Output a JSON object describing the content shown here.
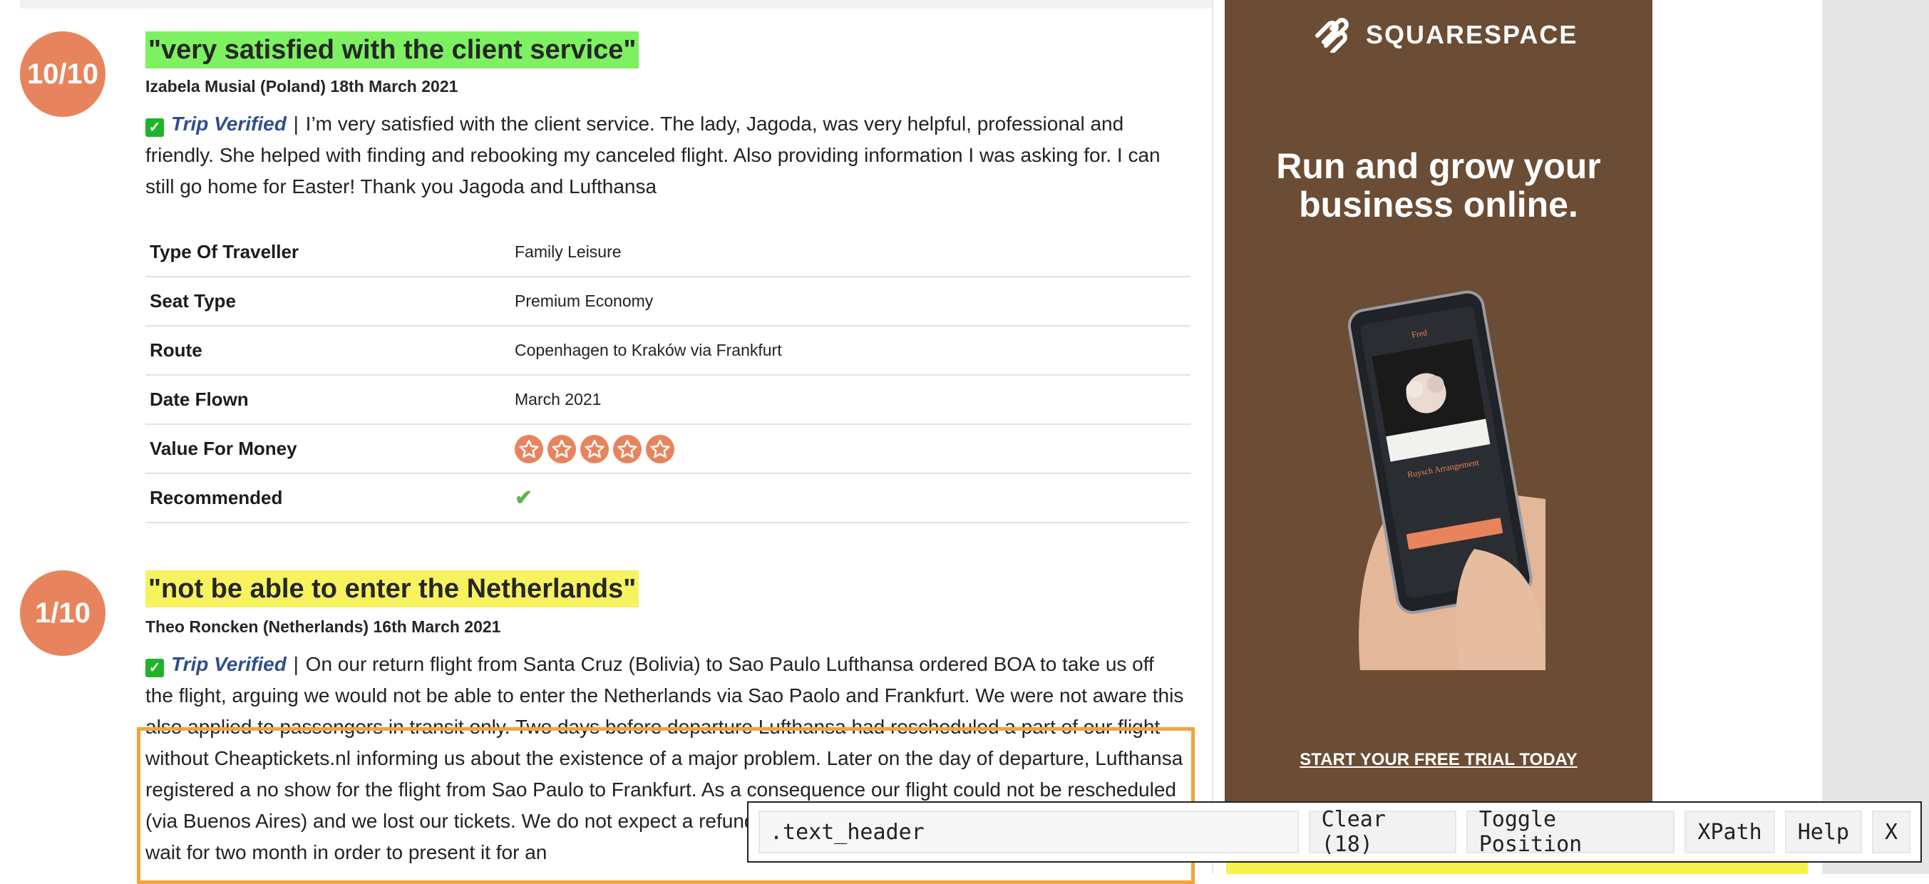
{
  "reviews": [
    {
      "rating": "10/10",
      "title": "\"very satisfied with the client service\"",
      "author": "Izabela Musial (Poland) 18th March 2021",
      "verified_label": "Trip Verified",
      "separator": "|",
      "text": "I’m very satisfied with the client service. The lady, Jagoda, was very helpful, professional and friendly. She helped with finding and rebooking my canceled flight. Also providing information I was asking for. I can still go home for Easter! Thank you Jagoda and Lufthansa",
      "details": [
        {
          "key": "Type Of Traveller",
          "value": "Family Leisure"
        },
        {
          "key": "Seat Type",
          "value": "Premium Economy"
        },
        {
          "key": "Route",
          "value": "Copenhagen to Kraków via Frankfurt"
        },
        {
          "key": "Date Flown",
          "value": "March 2021"
        },
        {
          "key": "Value For Money",
          "stars": 5
        },
        {
          "key": "Recommended",
          "icon": "checkmark-icon"
        }
      ]
    },
    {
      "rating": "1/10",
      "title": "\"not be able to enter the Netherlands\"",
      "author": "Theo Roncken (Netherlands) 16th March 2021",
      "verified_label": "Trip Verified",
      "separator": "|",
      "text": "On our return flight from Santa Cruz (Bolivia) to Sao Paulo Lufthansa ordered BOA to take us off the flight, arguing we would not be able to enter the Netherlands via Sao Paolo and Frankfurt. We were not aware this also applied to passengers in transit only. Two days before departure Lufthansa had rescheduled a part of our flight without Cheaptickets.nl informing us about the existence of a major problem. Later on the day of departure, Lufthansa registered a no show for the flight from Sao Paulo to Frankfurt. As a consequence our flight could not be rescheduled (via Buenos Aires) and we lost our tickets. We do not expect a refund for the tickets, and filed a claim but now have to wait for two month in order to present it for an"
    }
  ],
  "ad": {
    "brand": "SQUARESPACE",
    "headline_line1": "Run and grow your",
    "headline_line2": "business online.",
    "cta": "START YOUR FREE TRIAL TODAY",
    "phone_product": "Ruysch Arrangement",
    "phone_brand": "Fred",
    "bg_color": "#6b4c34"
  },
  "toolbar": {
    "selector_value": ".text_header",
    "clear_label": "Clear (18)",
    "toggle_label": "Toggle Position",
    "xpath_label": "XPath",
    "help_label": "Help",
    "close_label": "X"
  },
  "colors": {
    "badge": "#e8845d",
    "title_green": "#7ef162",
    "title_yellow": "#f7f35f",
    "verified_blue": "#2f4f8d",
    "highlight_orange": "#f2a43c"
  }
}
